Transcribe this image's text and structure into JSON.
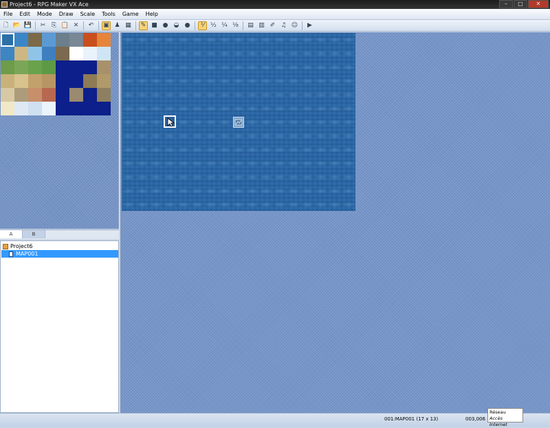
{
  "window": {
    "title": "Project6 - RPG Maker VX Ace",
    "buttons": [
      "–",
      "□",
      "✕"
    ]
  },
  "menu": [
    "File",
    "Edit",
    "Mode",
    "Draw",
    "Scale",
    "Tools",
    "Game",
    "Help"
  ],
  "toolbar": {
    "groups": [
      [
        {
          "icon": "new-project-icon",
          "glyph": "🗋"
        },
        {
          "icon": "open-project-icon",
          "glyph": "📂"
        },
        {
          "icon": "save-project-icon",
          "glyph": "💾"
        }
      ],
      [
        {
          "icon": "cut-icon",
          "glyph": "✂"
        },
        {
          "icon": "copy-icon",
          "glyph": "⎘"
        },
        {
          "icon": "paste-icon",
          "glyph": "📋"
        },
        {
          "icon": "delete-icon",
          "glyph": "✕"
        }
      ],
      [
        {
          "icon": "undo-icon",
          "glyph": "↶"
        }
      ],
      [
        {
          "icon": "map-mode-icon",
          "glyph": "▣",
          "active": true
        },
        {
          "icon": "event-mode-icon",
          "glyph": "♟"
        },
        {
          "icon": "region-mode-icon",
          "glyph": "▦"
        }
      ],
      [
        {
          "icon": "pencil-icon",
          "glyph": "✎",
          "active": true
        },
        {
          "icon": "rectangle-icon",
          "glyph": "■"
        },
        {
          "icon": "ellipse-icon",
          "glyph": "●"
        },
        {
          "icon": "fill-icon",
          "glyph": "◒"
        },
        {
          "icon": "shadow-pen-icon",
          "glyph": "●"
        }
      ],
      [
        {
          "icon": "zoom-1-1-icon",
          "glyph": "⅟",
          "active": true
        },
        {
          "icon": "zoom-1-2-icon",
          "glyph": "½"
        },
        {
          "icon": "zoom-1-4-icon",
          "glyph": "¼"
        },
        {
          "icon": "zoom-1-8-icon",
          "glyph": "⅛"
        }
      ],
      [
        {
          "icon": "database-icon",
          "glyph": "▤"
        },
        {
          "icon": "resource-manager-icon",
          "glyph": "▥"
        },
        {
          "icon": "script-editor-icon",
          "glyph": "✐"
        },
        {
          "icon": "sound-test-icon",
          "glyph": "♫"
        },
        {
          "icon": "character-generator-icon",
          "glyph": "☺"
        }
      ],
      [
        {
          "icon": "playtest-icon",
          "glyph": "▶"
        }
      ]
    ]
  },
  "colors": {
    "accent": "#3399ff",
    "map_water": "#2a66a3",
    "empty_area": "#6f8fc4"
  },
  "tileset": {
    "tabs": [
      {
        "label": "A",
        "active": true
      },
      {
        "label": "B",
        "active": false
      }
    ],
    "tiles": [
      [
        "#2d6fa8",
        "#3b86c6",
        "#7c6a46",
        "#5c9ad4",
        "#6b7f8c",
        "#7a8795",
        "#c94f1e",
        "#e6843a"
      ],
      [
        "#3e86c2",
        "#cfb784",
        "#8fc4e8",
        "#3f7fbf",
        "#7b6a50",
        "#ffffff",
        "#e9f3fb",
        "#cfe4f5"
      ],
      [
        "#6e9c4a",
        "#7ba657",
        "#6aa24b",
        "#5e9a45",
        "#0c1f8a",
        "#0c1f8a",
        "#0c1f8a",
        "#a8916a"
      ],
      [
        "#c9b27a",
        "#d8c38e",
        "#c2a16c",
        "#b89664",
        "#0c1f8a",
        "#0c1f8a",
        "#8e7a55",
        "#b19a6a"
      ],
      [
        "#d7c9a3",
        "#ad9c7a",
        "#c78f6a",
        "#b86850",
        "#0c1f8a",
        "#9a8a70",
        "#0c1f8a",
        "#8d8060"
      ],
      [
        "#f0e8c6",
        "#dfe9f4",
        "#cfe0f0",
        "#ebf3fb",
        "#0c1f8a",
        "#0c1f8a",
        "#0c1f8a",
        "#0c1f8a"
      ]
    ]
  },
  "tree": {
    "project": "Project6",
    "map": "MAP001"
  },
  "status": {
    "map_info": "001:MAP001 (17 x 13)",
    "coords": "003,006"
  },
  "tooltip": {
    "line1": "Réseau",
    "line2": "Accès Internet"
  }
}
